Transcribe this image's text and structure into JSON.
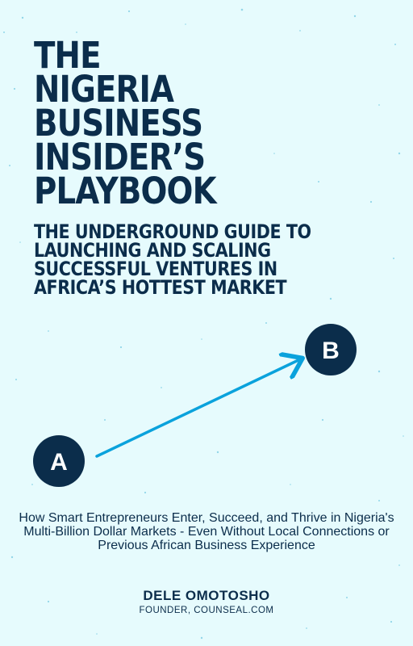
{
  "book": {
    "title_lines": [
      "THE",
      "NIGERIA BUSINESS",
      "INSIDER’S",
      "PLAYBOOK"
    ],
    "subtitle_lines": [
      "THE UNDERGROUND GUIDE TO",
      "LAUNCHING AND SCALING",
      "SUCCESSFUL VENTURES IN",
      "AFRICA’S HOTTEST MARKET"
    ],
    "description": "How Smart Entrepreneurs Enter, Succeed, and Thrive in Nigeria's Multi-Billion Dollar Markets - Even Without Local Connections or Previous African Business Experience",
    "author": "DELE OMOTOSHO",
    "author_role": "FOUNDER, COUNSEAL.COM"
  },
  "diagram": {
    "start_label": "A",
    "end_label": "B"
  },
  "colors": {
    "background": "#e6fbfd",
    "navy": "#0b2d4b",
    "arrow": "#0aa2dc"
  }
}
